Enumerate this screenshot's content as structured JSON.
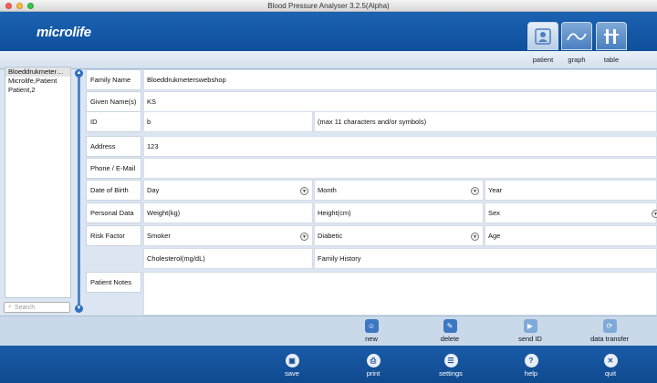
{
  "window": {
    "title": "Blood Pressure Analyser 3.2.5(Alpha)"
  },
  "brand": {
    "logo": "microlife"
  },
  "view_tabs": [
    {
      "label": "patient",
      "icon": "patient-icon"
    },
    {
      "label": "graph",
      "icon": "graph-icon"
    },
    {
      "label": "table",
      "icon": "table-icon"
    }
  ],
  "patients": [
    {
      "name": "Bloeddrukmeter…"
    },
    {
      "name": "Microlife,Patient"
    },
    {
      "name": "Patient,2"
    }
  ],
  "search": {
    "placeholder": "Search"
  },
  "form": {
    "family_name_label": "Family Name",
    "family_name_value": "Bloeddrukmeterswebshop",
    "given_names_label": "Given Name(s)",
    "given_names_value": "KS",
    "id_label": "ID",
    "id_value": "b",
    "id_hint": "(max 11 characters and/or symbols)",
    "address_label": "Address",
    "address_value": "123",
    "phone_label": "Phone / E-Mail",
    "phone_value": "",
    "dob_label": "Date of Birth",
    "dob_day": "Day",
    "dob_month": "Month",
    "dob_year": "Year",
    "personal_label": "Personal Data",
    "weight": "Weight(kg)",
    "height": "Height(cm)",
    "sex": "Sex",
    "risk_label": "Risk Factor",
    "smoker": "Smoker",
    "diabetic": "Diabetic",
    "age": "Age",
    "cholesterol": "Cholesterol(mg/dL)",
    "family_history": "Family History",
    "notes_label": "Patient Notes",
    "notes_value": ""
  },
  "actions": [
    {
      "label": "new",
      "icon": "new-patient-icon"
    },
    {
      "label": "delete",
      "icon": "delete-icon"
    },
    {
      "label": "send ID",
      "icon": "send-id-icon"
    },
    {
      "label": "data transfer",
      "icon": "data-transfer-icon"
    }
  ],
  "toolbar": [
    {
      "label": "save",
      "icon": "save-icon"
    },
    {
      "label": "print",
      "icon": "print-icon"
    },
    {
      "label": "settings",
      "icon": "settings-icon"
    },
    {
      "label": "help",
      "icon": "help-icon"
    },
    {
      "label": "quit",
      "icon": "quit-icon"
    }
  ],
  "colors": {
    "header": "#1c63b3",
    "panel": "#dce6f2",
    "accent": "#3c78c2"
  }
}
